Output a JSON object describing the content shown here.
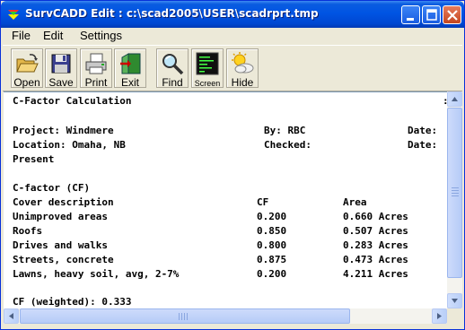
{
  "window": {
    "title": "SurvCADD Edit : c:\\scad2005\\USER\\scadrprt.tmp"
  },
  "menu": {
    "items": [
      "File",
      "Edit",
      "Settings"
    ]
  },
  "toolbar": {
    "buttons": [
      {
        "label": "Open",
        "icon": "folder-open-icon"
      },
      {
        "label": "Save",
        "icon": "floppy-disk-icon"
      },
      {
        "label": "Print",
        "icon": "printer-icon"
      },
      {
        "label": "Exit",
        "icon": "exit-door-icon"
      },
      {
        "label": "Find",
        "icon": "magnifier-icon"
      },
      {
        "label": "Screen",
        "icon": "monitor-icon"
      },
      {
        "label": "Hide",
        "icon": "sun-cloud-icon"
      }
    ]
  },
  "report": {
    "title": "C-Factor Calculation",
    "title_trailing": ":",
    "project_label": "Project: Windmere",
    "by_label": "By: RBC",
    "date_label": "Date:",
    "location_label": "Location: Omaha, NB",
    "checked_label": "Checked:",
    "date_label_2": "Date:",
    "present": "Present",
    "section_title": "C-factor (CF)",
    "columns": [
      "Cover description",
      "CF",
      "Area"
    ],
    "rows": [
      {
        "desc": "Unimproved areas",
        "cf": "0.200",
        "area": "0.660 Acres"
      },
      {
        "desc": "Roofs",
        "cf": "0.850",
        "area": "0.507 Acres"
      },
      {
        "desc": "Drives and walks",
        "cf": "0.800",
        "area": "0.283 Acres"
      },
      {
        "desc": "Streets, concrete",
        "cf": "0.875",
        "area": "0.473 Acres"
      },
      {
        "desc": "Lawns, heavy soil, avg, 2-7%",
        "cf": "0.200",
        "area": "4.211 Acres"
      }
    ],
    "weighted": "CF (weighted): 0.333"
  }
}
